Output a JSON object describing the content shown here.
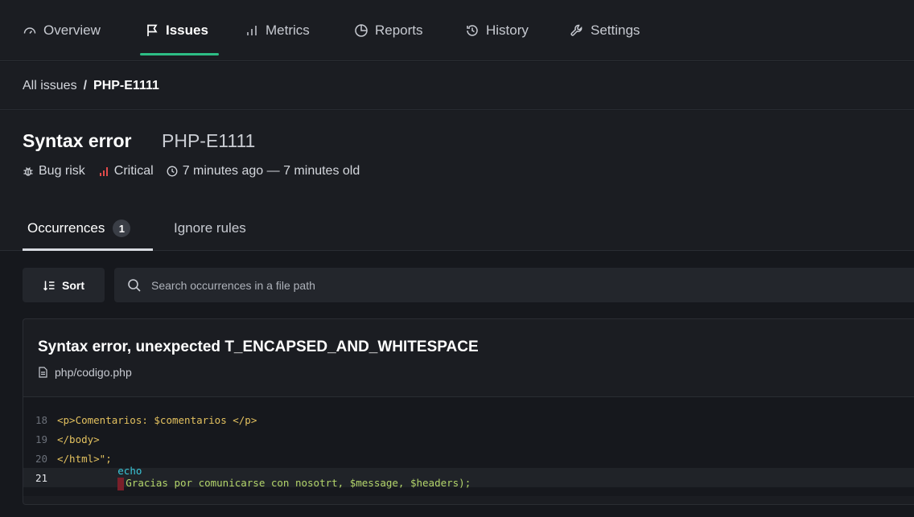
{
  "nav": {
    "items": [
      {
        "label": "Overview",
        "icon": "gauge-icon",
        "active": false
      },
      {
        "label": "Issues",
        "icon": "flag-icon",
        "active": true
      },
      {
        "label": "Metrics",
        "icon": "bar-chart-icon",
        "active": false
      },
      {
        "label": "Reports",
        "icon": "pie-chart-icon",
        "active": false
      },
      {
        "label": "History",
        "icon": "history-icon",
        "active": false
      },
      {
        "label": "Settings",
        "icon": "wrench-icon",
        "active": false
      }
    ]
  },
  "breadcrumb": {
    "parent": "All issues",
    "separator": "/",
    "current": "PHP-E1111"
  },
  "issue": {
    "title": "Syntax error",
    "code": "PHP-E1111",
    "category": "Bug risk",
    "severity": "Critical",
    "age": "7 minutes ago — 7 minutes old"
  },
  "tabs": [
    {
      "label": "Occurrences",
      "count": "1",
      "active": true
    },
    {
      "label": "Ignore rules",
      "active": false
    }
  ],
  "toolbar": {
    "sort_label": "Sort",
    "search_placeholder": "Search occurrences in a file path"
  },
  "occurrence": {
    "title": "Syntax error, unexpected T_ENCAPSED_AND_WHITESPACE",
    "path": "php/codigo.php",
    "lines": [
      {
        "num": "18",
        "text": "<p>Comentarios: $comentarios </p>"
      },
      {
        "num": "19",
        "text": "</body>"
      },
      {
        "num": "20",
        "text": "</html>\";"
      },
      {
        "num": "21",
        "keyword": "echo",
        "rest": "Gracias por comunicarse con nosotrt, $message, $headers);"
      }
    ]
  },
  "colors": {
    "accent": "#2dbd85",
    "critical": "#e24b4b",
    "background": "#16181d"
  }
}
